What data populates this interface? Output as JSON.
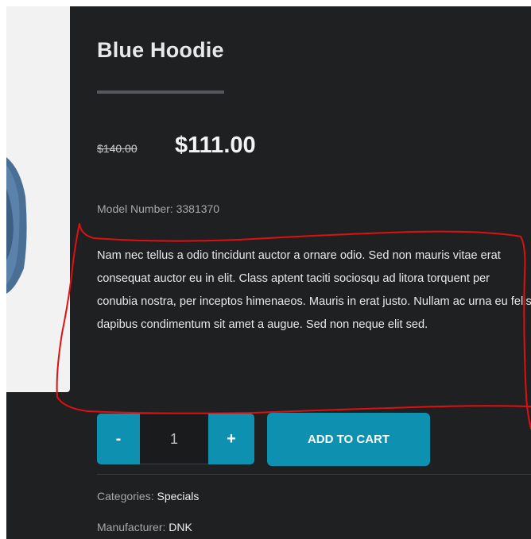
{
  "product": {
    "title": "Blue Hoodie",
    "old_price": "$140.00",
    "new_price": "$111.00",
    "model_label": "Model Number:",
    "model_number": "3381370",
    "description": "Nam nec tellus a odio tincidunt auctor a ornare odio. Sed non mauris vitae erat consequat auctor eu in elit. Class aptent taciti sociosqu ad litora torquent per conubia nostra, per inceptos himenaeos. Mauris in erat justo. Nullam ac urna eu felis dapibus condimentum sit amet a augue. Sed non neque elit sed."
  },
  "purchase": {
    "minus_label": "-",
    "quantity": "1",
    "plus_label": "+",
    "add_to_cart_label": "ADD TO CART"
  },
  "meta": {
    "categories_label": "Categories:",
    "categories_value": "Specials",
    "manufacturer_label": "Manufacturer:",
    "manufacturer_value": "DNK"
  },
  "colors": {
    "background": "#1f2022",
    "accent": "#0e90b0",
    "annotation": "#e01010"
  },
  "annotation": {
    "type": "hand-drawn red outline around product description"
  }
}
